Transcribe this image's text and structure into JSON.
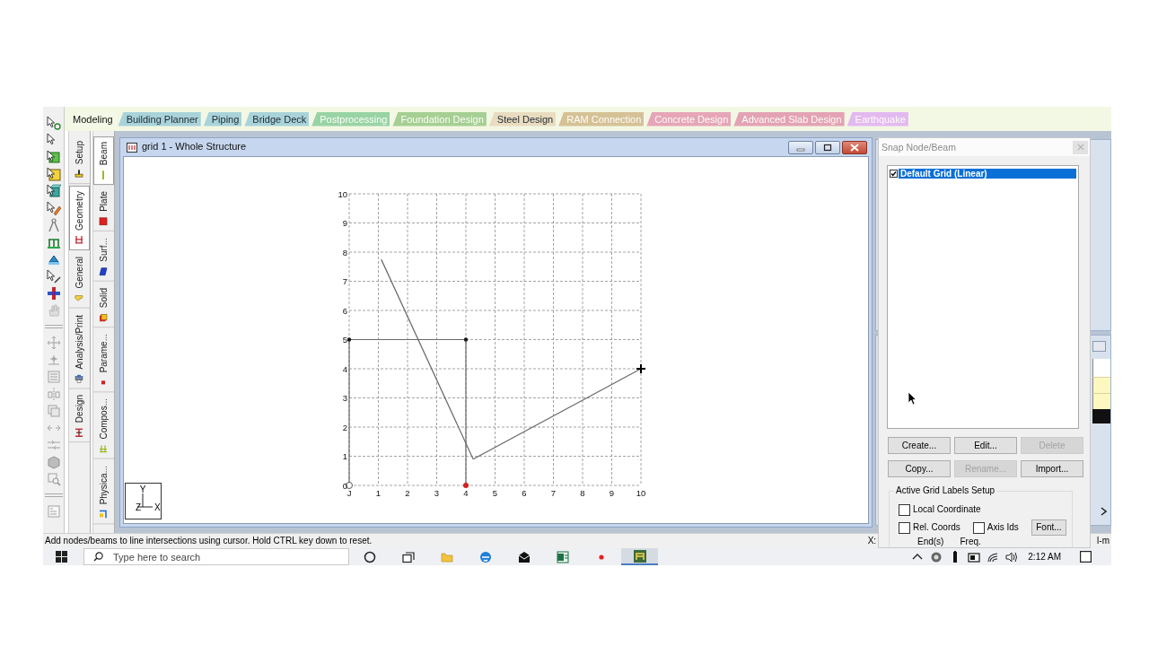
{
  "ribbon_tabs": [
    {
      "label": "Modeling",
      "selected": true,
      "disabled": false,
      "color": "#f4f8e6"
    },
    {
      "label": "Building Planner",
      "selected": false,
      "disabled": false,
      "color": "#a9d3da"
    },
    {
      "label": "Piping",
      "selected": false,
      "disabled": false,
      "color": "#a9d3da"
    },
    {
      "label": "Bridge Deck",
      "selected": false,
      "disabled": false,
      "color": "#a9d3da"
    },
    {
      "label": "Postprocessing",
      "selected": false,
      "disabled": true,
      "color": "#98d3a4"
    },
    {
      "label": "Foundation Design",
      "selected": false,
      "disabled": true,
      "color": "#a6cf93"
    },
    {
      "label": "Steel Design",
      "selected": false,
      "disabled": false,
      "color": "#e9dcc0"
    },
    {
      "label": "RAM Connection",
      "selected": false,
      "disabled": true,
      "color": "#d6c197"
    },
    {
      "label": "Concrete Design",
      "selected": false,
      "disabled": true,
      "color": "#e6a5b8"
    },
    {
      "label": "Advanced Slab Design",
      "selected": false,
      "disabled": true,
      "color": "#e3a3b5"
    },
    {
      "label": "Earthquake",
      "selected": false,
      "disabled": true,
      "color": "#e3b9f1"
    }
  ],
  "toolbar": [
    {
      "kind": "node-cursor",
      "disabled": false
    },
    {
      "kind": "arrow-cursor",
      "disabled": false
    },
    {
      "kind": "beam-cursor",
      "disabled": false
    },
    {
      "kind": "plate-cursor",
      "disabled": false
    },
    {
      "kind": "solid-cursor",
      "disabled": false
    },
    {
      "kind": "surface-cursor",
      "disabled": false
    },
    {
      "kind": "angle",
      "disabled": false
    },
    {
      "kind": "support",
      "disabled": false
    },
    {
      "kind": "load",
      "disabled": false
    },
    {
      "kind": "edit-cursor",
      "disabled": false
    },
    {
      "kind": "plus",
      "disabled": false
    },
    {
      "kind": "hand",
      "disabled": true
    },
    {
      "kind": "move",
      "disabled": true
    },
    {
      "kind": "insert",
      "disabled": true
    },
    {
      "kind": "lines",
      "disabled": true
    },
    {
      "kind": "mirror",
      "disabled": true
    },
    {
      "kind": "copy",
      "disabled": true
    },
    {
      "kind": "split",
      "disabled": true
    },
    {
      "kind": "join",
      "disabled": true
    },
    {
      "kind": "block",
      "disabled": true
    },
    {
      "kind": "zoom",
      "disabled": true
    },
    {
      "kind": "list",
      "disabled": true
    }
  ],
  "page_tabs": [
    {
      "label": "Setup",
      "selected": false
    },
    {
      "label": "Geometry",
      "selected": true
    },
    {
      "label": "General",
      "selected": false
    },
    {
      "label": "Analysis/Print",
      "selected": false
    },
    {
      "label": "Design",
      "selected": false
    }
  ],
  "geometry_tabs": [
    {
      "label": "Beam",
      "selected": true
    },
    {
      "label": "Plate",
      "selected": false
    },
    {
      "label": "Surf...",
      "selected": false
    },
    {
      "label": "Solid",
      "selected": false
    },
    {
      "label": "Parame...",
      "selected": false
    },
    {
      "label": "Compos...",
      "selected": false
    },
    {
      "label": "Physica...",
      "selected": false
    }
  ],
  "view_window": {
    "title": "grid 1 - Whole Structure",
    "y_labels": [
      "10",
      "9",
      "8",
      "7",
      "6",
      "5",
      "4",
      "3",
      "2",
      "1",
      "0"
    ],
    "x_labels": [
      "J",
      "1",
      "2",
      "3",
      "4",
      "5",
      "6",
      "7",
      "8",
      "9",
      "10"
    ],
    "axis_labels": [
      "Y",
      "Z",
      "X"
    ]
  },
  "snap_dialog": {
    "title": "Snap Node/Beam",
    "grids": [
      {
        "label": "Default Grid (Linear)",
        "checked": true,
        "selected": true
      }
    ],
    "buttons": [
      {
        "label": "Create...",
        "disabled": false
      },
      {
        "label": "Edit...",
        "disabled": false
      },
      {
        "label": "Delete",
        "disabled": true
      },
      {
        "label": "Copy...",
        "disabled": false
      },
      {
        "label": "Rename...",
        "disabled": true
      },
      {
        "label": "Import...",
        "disabled": false
      }
    ],
    "labels_setup": {
      "title": "Active Grid Labels Setup",
      "options": [
        {
          "label": "Local Coordinate",
          "checked": false
        },
        {
          "label": "Rel. Coords",
          "checked": false
        },
        {
          "label": "Axis Ids",
          "checked": false
        }
      ],
      "font_button": "Font...",
      "columns": [
        "End(s)",
        "Freq."
      ]
    }
  },
  "status_bar": {
    "message": "Add nodes/beams to line intersections using cursor. Hold CTRL key down to reset.",
    "coord_label": "X:",
    "units": "l-m"
  },
  "taskbar": {
    "search": {
      "placeholder": "Type here to search"
    },
    "apps": [
      {
        "kind": "circle",
        "active": false
      },
      {
        "kind": "task-view",
        "active": false
      },
      {
        "kind": "folder",
        "active": false
      },
      {
        "kind": "browser",
        "active": false
      },
      {
        "kind": "envelope",
        "active": false
      },
      {
        "kind": "spreadsheet",
        "active": false
      },
      {
        "kind": "record",
        "active": false
      },
      {
        "kind": "structure",
        "active": true
      }
    ],
    "time": "2:12 AM"
  }
}
